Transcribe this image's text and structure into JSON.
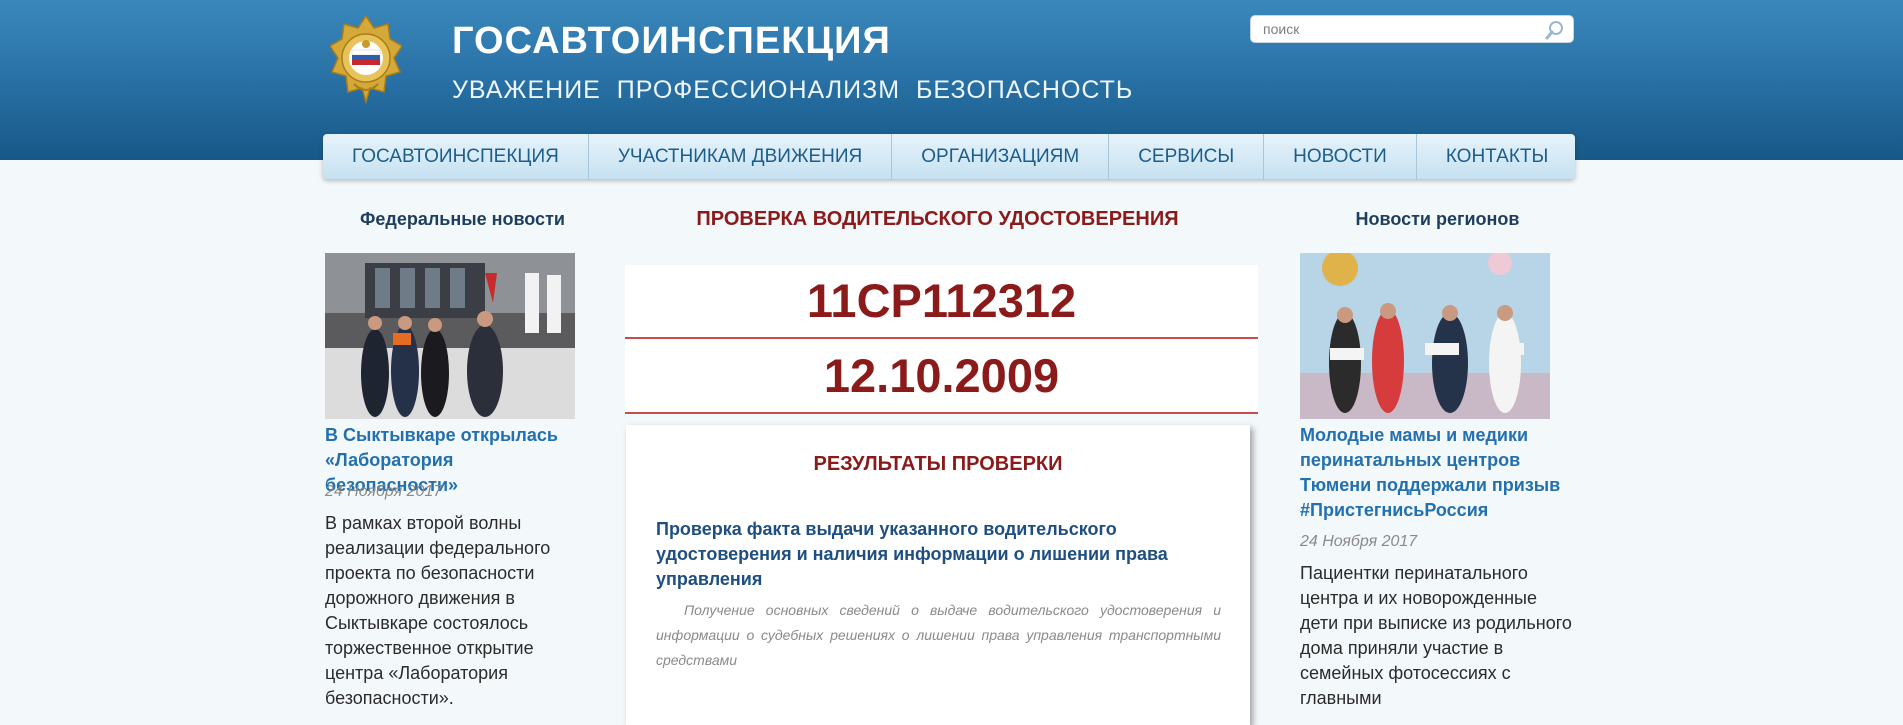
{
  "header": {
    "title": "ГОСАВТОИНСПЕКЦИЯ",
    "slogan": "УВАЖЕНИЕ  ПРОФЕССИОНАЛИЗМ  БЕЗОПАСНОСТЬ",
    "search_placeholder": "поиск",
    "search_icon": "magnifier-icon",
    "emblem": "gibdd-emblem"
  },
  "nav": {
    "items": [
      {
        "label": "Госавтоинспекция"
      },
      {
        "label": "Участникам движения"
      },
      {
        "label": "Организациям"
      },
      {
        "label": "Сервисы"
      },
      {
        "label": "Новости"
      },
      {
        "label": "Контакты"
      }
    ]
  },
  "federal_news": {
    "heading": "Федеральные новости",
    "title": "В Сыктывкаре открылась «Лаборатория безопасности»",
    "date": "24 Ноября 2017",
    "text": "В рамках второй волны реализации федерального проекта по безопасности дорожного движения в Сыктывкаре состоялось торжественное открытие центра «Лаборатория безопасности»."
  },
  "main": {
    "title": "ПРОВЕРКА ВОДИТЕЛЬСКОГО УДОСТОВЕРЕНИЯ",
    "license_number": "11СР112312",
    "issue_date": "12.10.2009",
    "results_title": "РЕЗУЛЬТАТЫ ПРОВЕРКИ",
    "check_title": "Проверка факта выдачи указанного водительского удостоверения и наличия информации о лишении права управления",
    "check_desc": "Получение основных сведений о выдаче водительского удостоверения и информации о судебных решениях о лишении права управления транспортными средствами"
  },
  "regional_news": {
    "heading": "Новости регионов",
    "title": "Молодые мамы и медики перинатальных центров Тюмени поддержали призыв #ПристегнисьРоссия",
    "date": "24 Ноября 2017",
    "text": "Пациентки перинатального центра и их новорожденные дети при выписке из родильного дома приняли участие в семейных фотосессиях с главными"
  },
  "colors": {
    "header_top": "#3a88bb",
    "header_bottom": "#175887",
    "accent_red": "#8b1a1a",
    "link_blue": "#2370b0"
  }
}
